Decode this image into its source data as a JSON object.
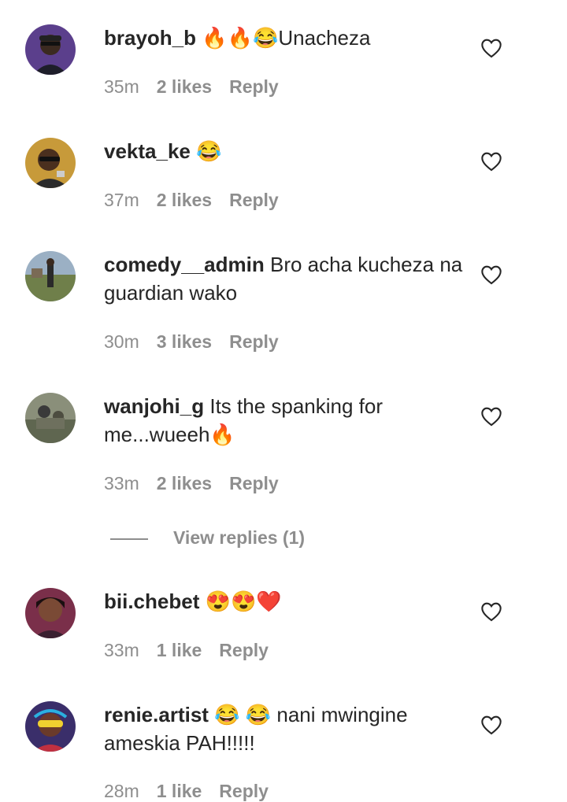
{
  "comments": [
    {
      "username": "brayoh_b",
      "text": " 🔥🔥😂Unacheza",
      "time": "35m",
      "likes": "2 likes",
      "reply": "Reply",
      "avatar_color": "#5b3f8c"
    },
    {
      "username": "vekta_ke",
      "text": " 😂",
      "time": "37m",
      "likes": "2 likes",
      "reply": "Reply",
      "avatar_color": "#c79a3a"
    },
    {
      "username": "comedy__admin",
      "text": " Bro acha kucheza na guardian wako",
      "time": "30m",
      "likes": "3 likes",
      "reply": "Reply",
      "avatar_color": "#6f7f4a"
    },
    {
      "username": "wanjohi_g",
      "text": " Its the spanking for me...wueeh🔥",
      "time": "33m",
      "likes": "2 likes",
      "reply": "Reply",
      "avatar_color": "#5f6650"
    },
    {
      "username": "bii.chebet",
      "text": " 😍😍❤️",
      "time": "33m",
      "likes": "1 like",
      "reply": "Reply",
      "avatar_color": "#7a2f4a"
    },
    {
      "username": "renie.artist",
      "text": " 😂 😂 nani mwingine ameskia PAH!!!!!",
      "time": "28m",
      "likes": "1 like",
      "reply": "Reply",
      "avatar_color": "#3a2e6a"
    }
  ],
  "view_replies": "View replies (1)",
  "colors": {
    "text": "#262626",
    "muted": "#8e8e8e",
    "background": "#ffffff"
  },
  "icons": {
    "like": "heart-outline-icon"
  }
}
